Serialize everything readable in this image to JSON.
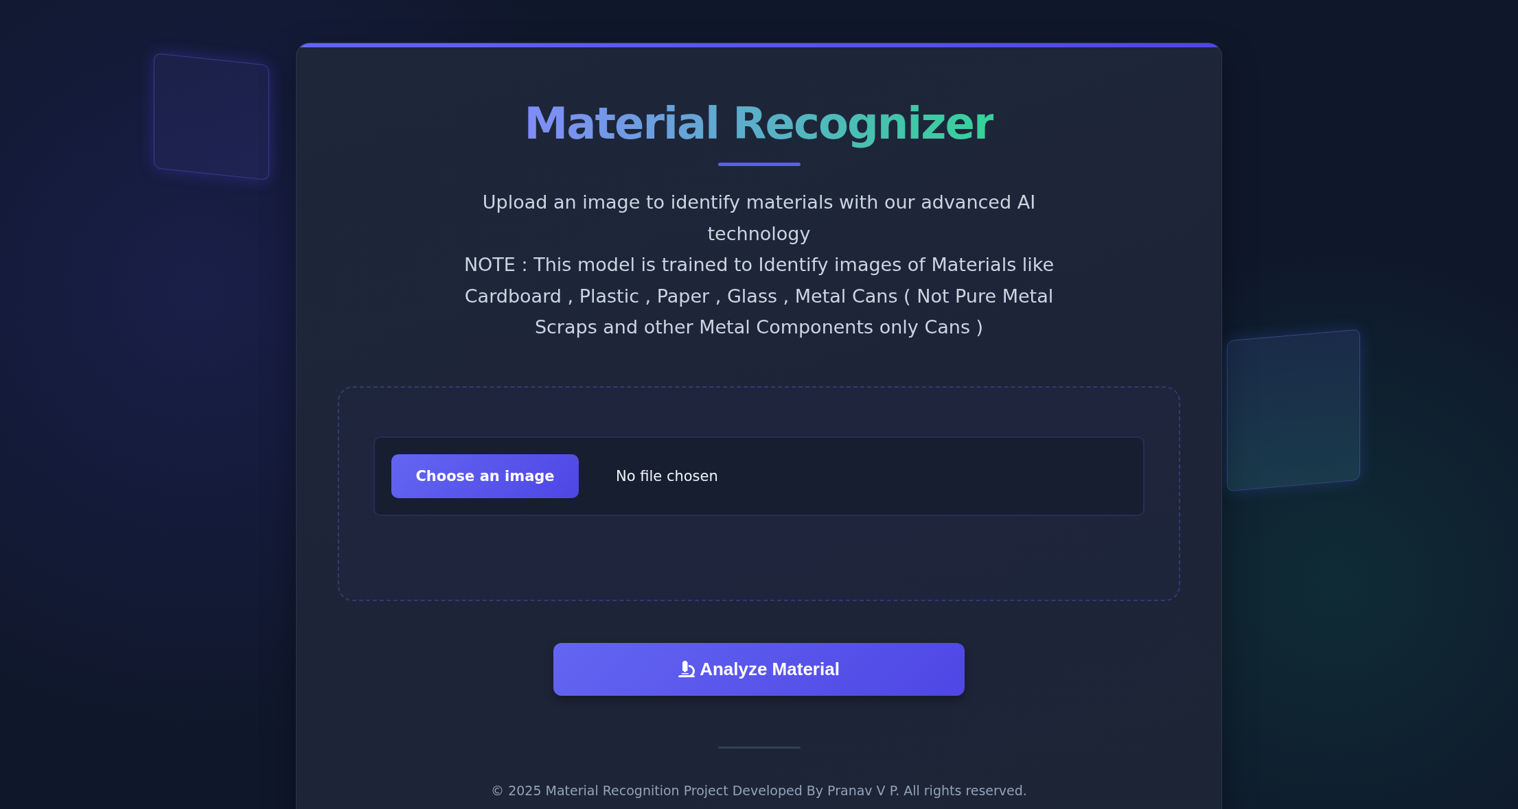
{
  "header": {
    "title": "Material Recognizer"
  },
  "description": [
    "Upload an image to identify materials with our advanced AI technology",
    "NOTE : This model is trained to Identify images of Materials like Cardboard , Plastic , Paper , Glass , Metal Cans ( Not Pure Metal Scraps and other Metal Components only Cans )"
  ],
  "upload": {
    "button": "Choose an image",
    "file_status": "No file chosen"
  },
  "analyze_button": {
    "label": "Analyze Material"
  },
  "footer": {
    "text": "© 2025 Material Recognition Project Developed By Pranav V P. All rights reserved."
  }
}
